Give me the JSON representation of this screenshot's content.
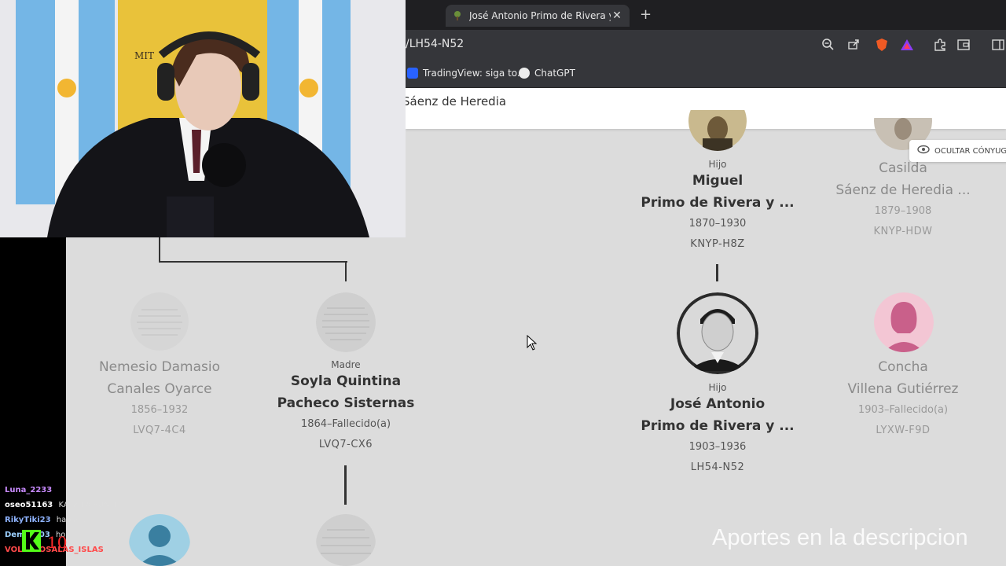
{
  "browser": {
    "tab_title": "José Antonio Primo de Rivera y S",
    "tab_close": "✕",
    "new_tab": "+",
    "url": "/LH54-N52",
    "bookmarks": [
      {
        "label": "TradingView: siga to..."
      },
      {
        "label": "ChatGPT"
      }
    ]
  },
  "page": {
    "header_title": "Sáenz de Heredia",
    "hide_spouses_button": "OCULTAR CÓNYUG"
  },
  "tree": {
    "miguel": {
      "role": "Hijo",
      "name1": "Miguel",
      "name2": "Primo de Rivera y ...",
      "dates": "1870–1930",
      "id": "KNYP-H8Z"
    },
    "casilda": {
      "name1": "Casilda",
      "name2": "Sáenz de Heredia ...",
      "dates": "1879–1908",
      "id": "KNYP-HDW"
    },
    "nemesio": {
      "name1": "Nemesio Damasio",
      "name2": "Canales Oyarce",
      "dates": "1856–1932",
      "id": "LVQ7-4C4"
    },
    "soyla": {
      "role": "Madre",
      "name1": "Soyla Quintina",
      "name2": "Pacheco Sisternas",
      "dates": "1864–Fallecido(a)",
      "id": "LVQ7-CX6"
    },
    "jose_antonio": {
      "role": "Hijo",
      "name1": "José Antonio",
      "name2": "Primo de Rivera y ...",
      "dates": "1903–1936",
      "id": "LH54-N52"
    },
    "concha": {
      "name1": "Concha",
      "name2": "Villena Gutiérrez",
      "dates": "1903–Fallecido(a)",
      "id": "LYXW-F9D"
    }
  },
  "overlay": {
    "watermark": "Aportes en la descripcion",
    "flag_text": "MIT",
    "chat": [
      {
        "user": "Luna_2233",
        "msg": "",
        "color": "#c98bff"
      },
      {
        "user": "oseo51163",
        "msg": "KATZ LA PUNTEL",
        "color": "#ffffff"
      },
      {
        "user": "RikyTiki23",
        "msg": "habia...",
        "color": "#8fb4ff"
      },
      {
        "user": "Dem...503",
        "msg": "ho...",
        "color": "#9cd0ff"
      },
      {
        "user": "VOL...MOSALAS_ISLAS",
        "msg": "...",
        "color": "#ff4a4a"
      }
    ],
    "badge": "10"
  }
}
